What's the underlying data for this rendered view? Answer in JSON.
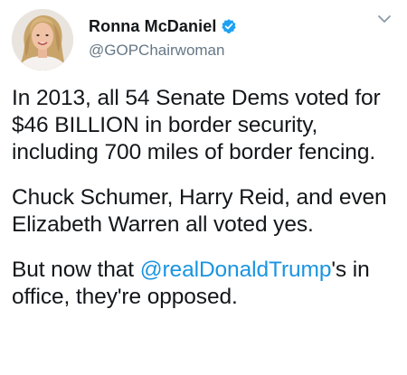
{
  "author": {
    "display_name": "Ronna McDaniel",
    "handle": "@GOPChairwoman",
    "verified": true,
    "avatar": "profile-photo-woman-blonde"
  },
  "menu_icon": "chevron-down-icon",
  "tweet": {
    "paragraph1": "In 2013, all 54 Senate Dems voted for $46 BILLION in border security, including 700 miles of border fencing.",
    "paragraph2": "Chuck Schumer, Harry Reid, and even Elizabeth Warren all voted  yes.",
    "paragraph3_prefix": "But now that ",
    "mention": "@realDonaldTrump",
    "paragraph3_suffix": "'s in office, they're opposed."
  },
  "colors": {
    "text": "#14171a",
    "secondary": "#657786",
    "link": "#1b95e0",
    "verified_badge": "#1da1f2"
  }
}
